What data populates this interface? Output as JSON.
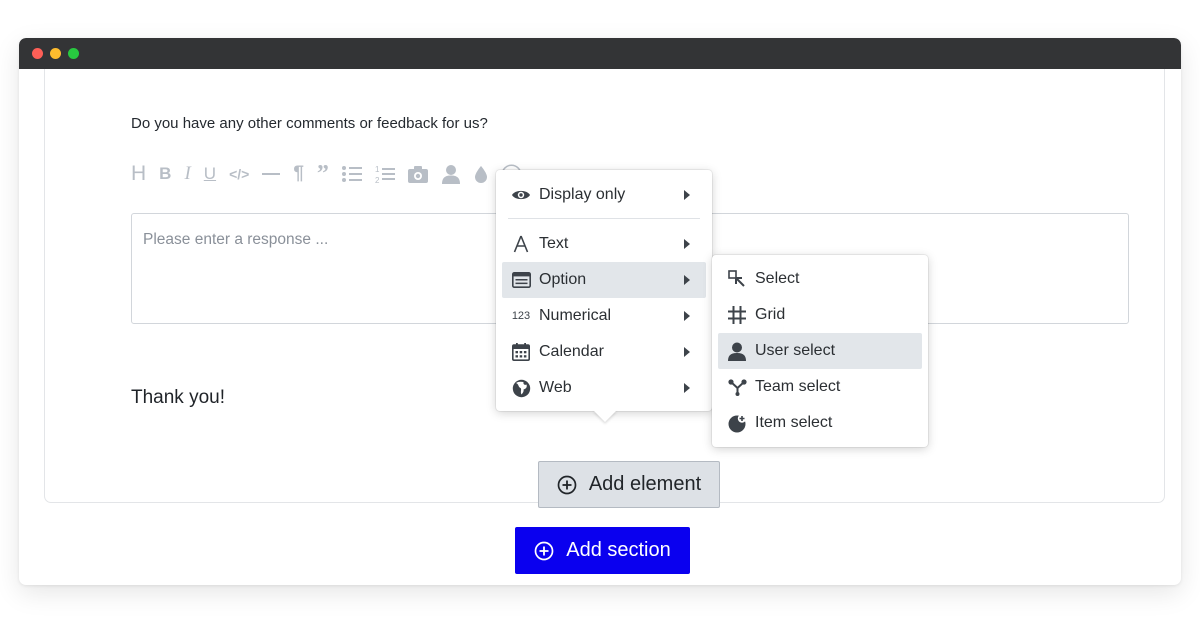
{
  "window": {
    "controls": [
      "close",
      "minimize",
      "maximize"
    ]
  },
  "form": {
    "question": "Do you have any other comments or feedback for us?",
    "toolbar_icons": [
      "heading-icon",
      "bold-icon",
      "italic-icon",
      "underline-icon",
      "code-icon",
      "horizontal-rule-icon",
      "paragraph-icon",
      "quote-icon",
      "bullet-list-icon",
      "numbered-list-icon",
      "camera-icon",
      "user-icon",
      "drop-icon",
      "smiley-icon"
    ],
    "response_placeholder": "Please enter a response ...",
    "thanks_text": "Thank you!",
    "add_element_label": "Add element",
    "add_section_label": "Add section"
  },
  "menu": {
    "items": [
      {
        "label": "Display only",
        "icon": "eye-icon"
      },
      {
        "label": "Text",
        "icon": "text-a-icon"
      },
      {
        "label": "Option",
        "icon": "list-box-icon",
        "active": true
      },
      {
        "label": "Numerical",
        "icon": "numbers-123-icon",
        "icon_text": "123"
      },
      {
        "label": "Calendar",
        "icon": "calendar-icon"
      },
      {
        "label": "Web",
        "icon": "globe-icon"
      }
    ]
  },
  "submenu": {
    "items": [
      {
        "label": "Select",
        "icon": "select-cursor-icon"
      },
      {
        "label": "Grid",
        "icon": "grid-icon"
      },
      {
        "label": "User select",
        "icon": "user-icon",
        "active": true
      },
      {
        "label": "Team select",
        "icon": "team-icon"
      },
      {
        "label": "Item select",
        "icon": "item-icon"
      }
    ]
  },
  "colors": {
    "titlebar": "#333436",
    "primary_button": "#0a00ef",
    "secondary_button": "#dde1e6",
    "menu_active": "#e2e6ea"
  }
}
